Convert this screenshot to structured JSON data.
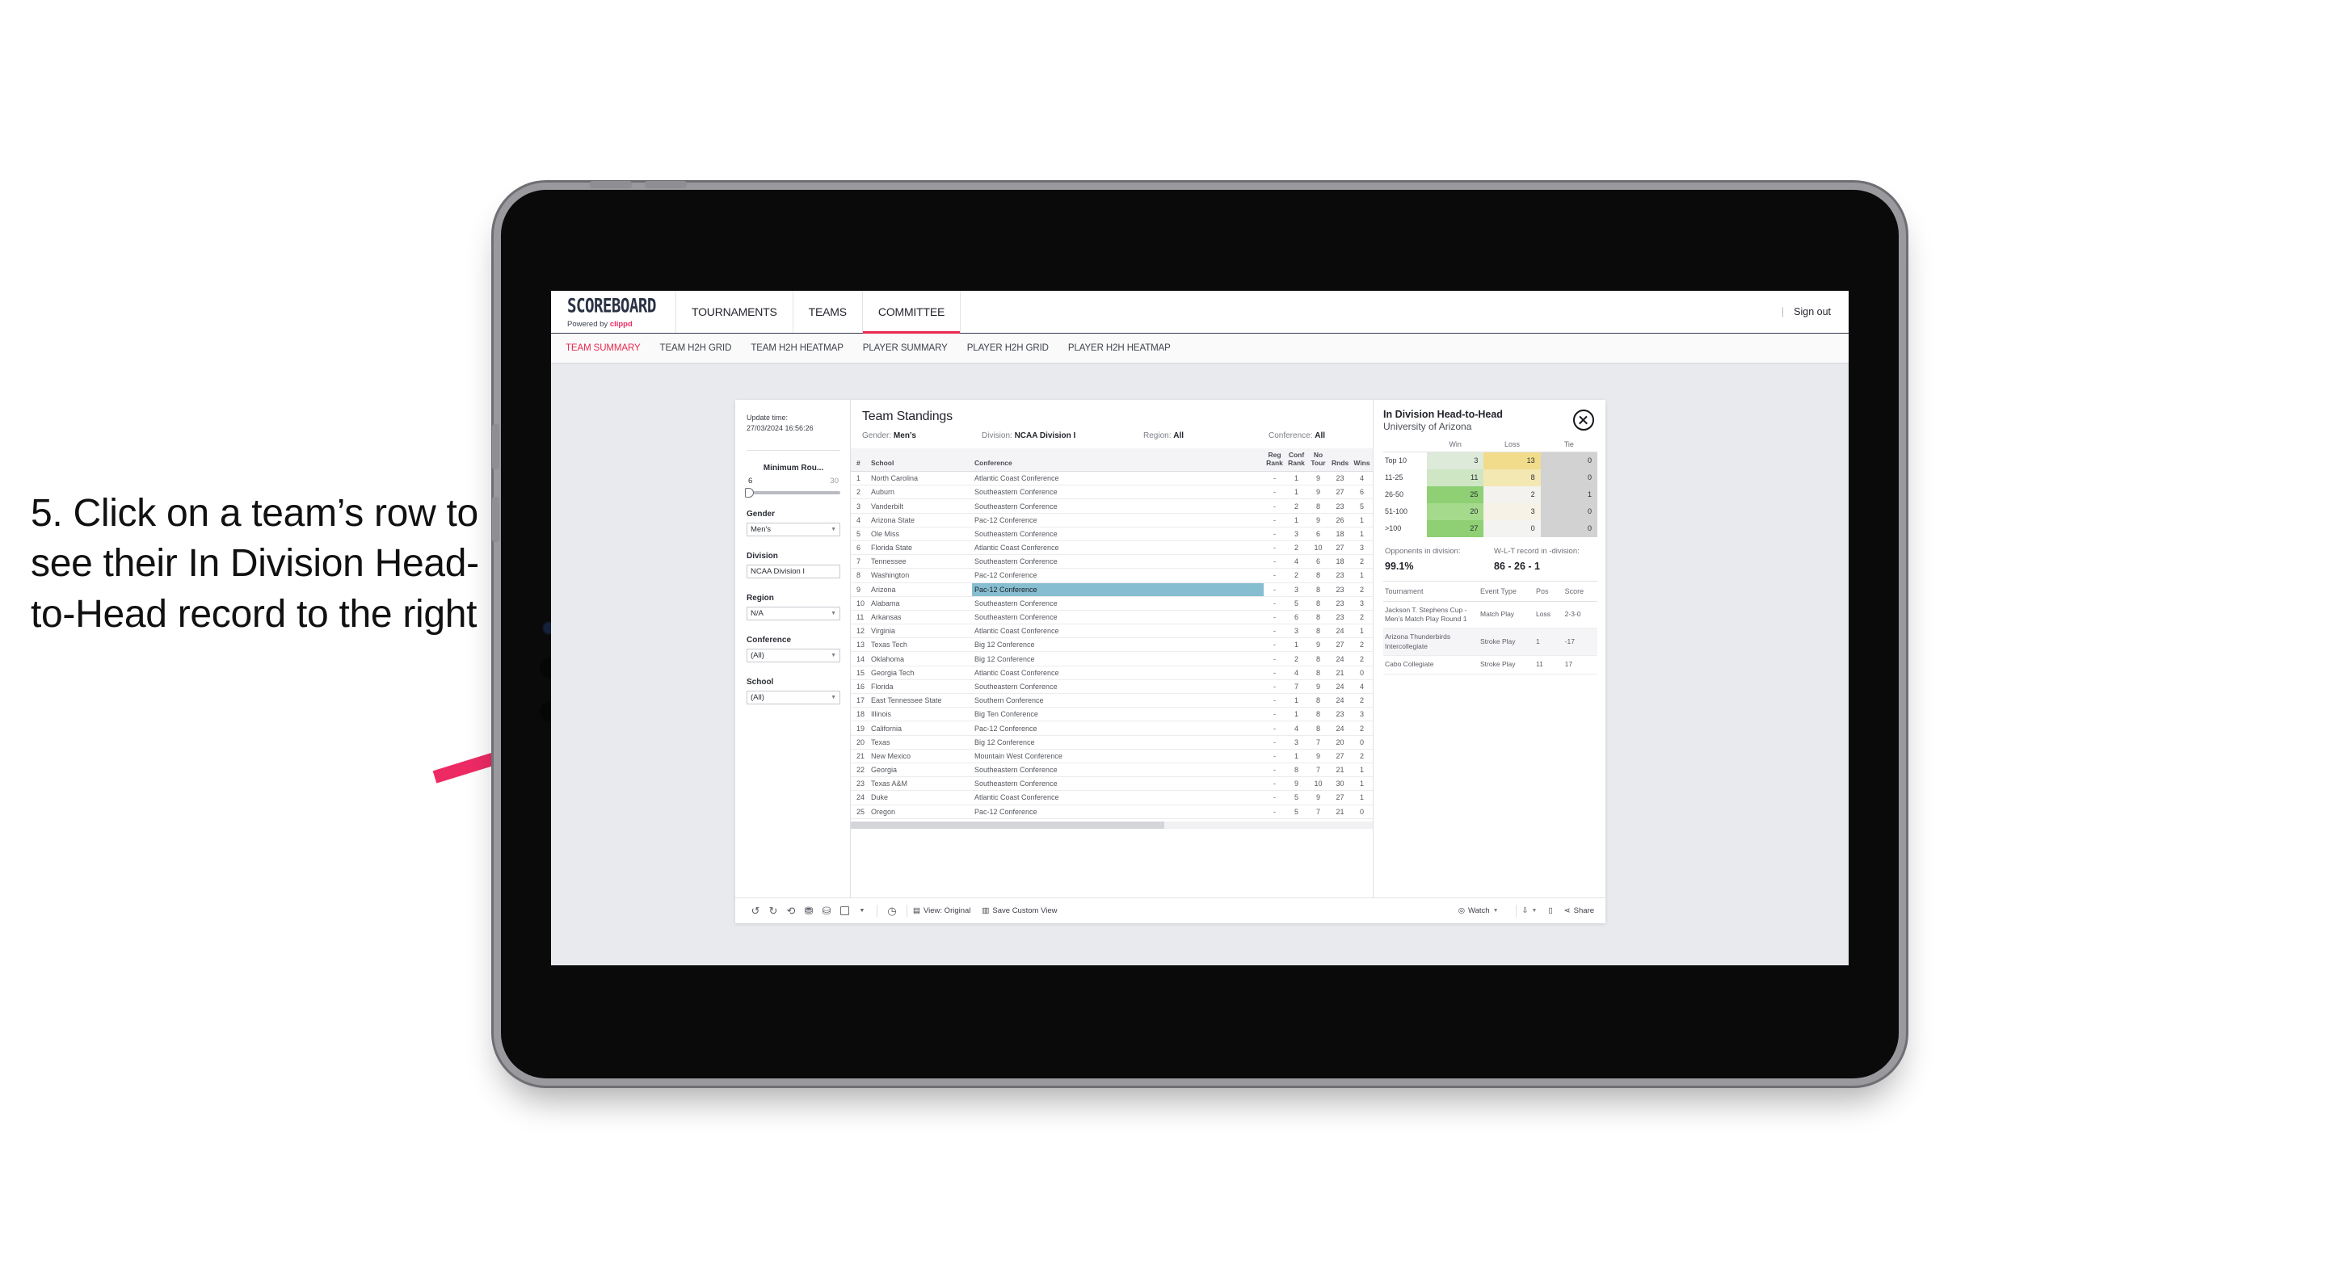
{
  "instruction": "5. Click on a team’s row to see their In Division Head-to-Head record to the right",
  "colors": {
    "accent_pink": "#e8294f",
    "arrow_pink": "#ee2a64",
    "selected_row": "#86bdd0"
  },
  "app": {
    "brand": {
      "word": "SCOREBOARD",
      "powered_prefix": "Powered by",
      "powered_name": "clippd"
    },
    "topnav": [
      {
        "label": "TOURNAMENTS",
        "active": false
      },
      {
        "label": "TEAMS",
        "active": false
      },
      {
        "label": "COMMITTEE",
        "active": true
      }
    ],
    "signout_label": "Sign out",
    "subnav": [
      {
        "label": "TEAM SUMMARY",
        "active": true
      },
      {
        "label": "TEAM H2H GRID",
        "active": false
      },
      {
        "label": "TEAM H2H HEATMAP",
        "active": false
      },
      {
        "label": "PLAYER SUMMARY",
        "active": false
      },
      {
        "label": "PLAYER H2H GRID",
        "active": false
      },
      {
        "label": "PLAYER H2H HEATMAP",
        "active": false
      }
    ]
  },
  "filters": {
    "update_time_label": "Update time:",
    "update_time_value": "27/03/2024 16:56:26",
    "slider": {
      "title": "Minimum Rou...",
      "min": "6",
      "max": "30"
    },
    "groups": [
      {
        "title": "Gender",
        "value": "Men's"
      },
      {
        "title": "Division",
        "value": "NCAA Division I"
      },
      {
        "title": "Region",
        "value": "N/A"
      },
      {
        "title": "Conference",
        "value": "(All)"
      },
      {
        "title": "School",
        "value": "(All)"
      }
    ]
  },
  "standings": {
    "title": "Team Standings",
    "meta": [
      {
        "label": "Gender:",
        "value": "Men’s"
      },
      {
        "label": "Division:",
        "value": "NCAA Division I"
      },
      {
        "label": "Region:",
        "value": "All"
      },
      {
        "label": "Conference:",
        "value": "All"
      }
    ],
    "columns": [
      "#",
      "School",
      "Conference",
      "Reg Rank",
      "Conf Rank",
      "No Tour",
      "Rnds",
      "Wins"
    ],
    "rows": [
      [
        "1",
        "North Carolina",
        "Atlantic Coast Conference",
        "-",
        "1",
        "9",
        "23",
        "4"
      ],
      [
        "2",
        "Auburn",
        "Southeastern Conference",
        "-",
        "1",
        "9",
        "27",
        "6"
      ],
      [
        "3",
        "Vanderbilt",
        "Southeastern Conference",
        "-",
        "2",
        "8",
        "23",
        "5"
      ],
      [
        "4",
        "Arizona State",
        "Pac-12 Conference",
        "-",
        "1",
        "9",
        "26",
        "1"
      ],
      [
        "5",
        "Ole Miss",
        "Southeastern Conference",
        "-",
        "3",
        "6",
        "18",
        "1"
      ],
      [
        "6",
        "Florida State",
        "Atlantic Coast Conference",
        "-",
        "2",
        "10",
        "27",
        "3"
      ],
      [
        "7",
        "Tennessee",
        "Southeastern Conference",
        "-",
        "4",
        "6",
        "18",
        "2"
      ],
      [
        "8",
        "Washington",
        "Pac-12 Conference",
        "-",
        "2",
        "8",
        "23",
        "1"
      ],
      [
        "9",
        "Arizona",
        "Pac-12 Conference",
        "-",
        "3",
        "8",
        "23",
        "2"
      ],
      [
        "10",
        "Alabama",
        "Southeastern Conference",
        "-",
        "5",
        "8",
        "23",
        "3"
      ],
      [
        "11",
        "Arkansas",
        "Southeastern Conference",
        "-",
        "6",
        "8",
        "23",
        "2"
      ],
      [
        "12",
        "Virginia",
        "Atlantic Coast Conference",
        "-",
        "3",
        "8",
        "24",
        "1"
      ],
      [
        "13",
        "Texas Tech",
        "Big 12 Conference",
        "-",
        "1",
        "9",
        "27",
        "2"
      ],
      [
        "14",
        "Oklahoma",
        "Big 12 Conference",
        "-",
        "2",
        "8",
        "24",
        "2"
      ],
      [
        "15",
        "Georgia Tech",
        "Atlantic Coast Conference",
        "-",
        "4",
        "8",
        "21",
        "0"
      ],
      [
        "16",
        "Florida",
        "Southeastern Conference",
        "-",
        "7",
        "9",
        "24",
        "4"
      ],
      [
        "17",
        "East Tennessee State",
        "Southern Conference",
        "-",
        "1",
        "8",
        "24",
        "2"
      ],
      [
        "18",
        "Illinois",
        "Big Ten Conference",
        "-",
        "1",
        "8",
        "23",
        "3"
      ],
      [
        "19",
        "California",
        "Pac-12 Conference",
        "-",
        "4",
        "8",
        "24",
        "2"
      ],
      [
        "20",
        "Texas",
        "Big 12 Conference",
        "-",
        "3",
        "7",
        "20",
        "0"
      ],
      [
        "21",
        "New Mexico",
        "Mountain West Conference",
        "-",
        "1",
        "9",
        "27",
        "2"
      ],
      [
        "22",
        "Georgia",
        "Southeastern Conference",
        "-",
        "8",
        "7",
        "21",
        "1"
      ],
      [
        "23",
        "Texas A&M",
        "Southeastern Conference",
        "-",
        "9",
        "10",
        "30",
        "1"
      ],
      [
        "24",
        "Duke",
        "Atlantic Coast Conference",
        "-",
        "5",
        "9",
        "27",
        "1"
      ],
      [
        "25",
        "Oregon",
        "Pac-12 Conference",
        "-",
        "5",
        "7",
        "21",
        "0"
      ]
    ],
    "selected_row_index": 8
  },
  "h2h_panel": {
    "title": "In Division Head-to-Head",
    "subtitle": "University of Arizona",
    "close_icon": "close-circle-icon",
    "matrix_headers": [
      "Win",
      "Loss",
      "Tie"
    ],
    "matrix_rows": [
      {
        "label": "Top 10",
        "win": "3",
        "loss": "13",
        "tie": "0"
      },
      {
        "label": "11-25",
        "win": "11",
        "loss": "8",
        "tie": "0"
      },
      {
        "label": "26-50",
        "win": "25",
        "loss": "2",
        "tie": "1"
      },
      {
        "label": "51-100",
        "win": "20",
        "loss": "3",
        "tie": "0"
      },
      {
        "label": ">100",
        "win": "27",
        "loss": "0",
        "tie": "0"
      }
    ],
    "summary": [
      {
        "label": "Opponents in division:",
        "value": "99.1%"
      },
      {
        "label": "W-L-T record in -division:",
        "value": "86 - 26 - 1"
      }
    ],
    "tournament_columns": [
      "Tournament",
      "Event Type",
      "Pos",
      "Score"
    ],
    "tournaments": [
      [
        "Jackson T. Stephens Cup - Men’s Match Play Round 1",
        "Match Play",
        "Loss",
        "2-3-0"
      ],
      [
        "Arizona Thunderbirds Intercollegiate",
        "Stroke Play",
        "1",
        "-17"
      ],
      [
        "Cabo Collegiate",
        "Stroke Play",
        "11",
        "17"
      ]
    ]
  },
  "toolbar": {
    "view_label": "View: Original",
    "save_label": "Save Custom View",
    "watch_label": "Watch",
    "share_label": "Share"
  }
}
